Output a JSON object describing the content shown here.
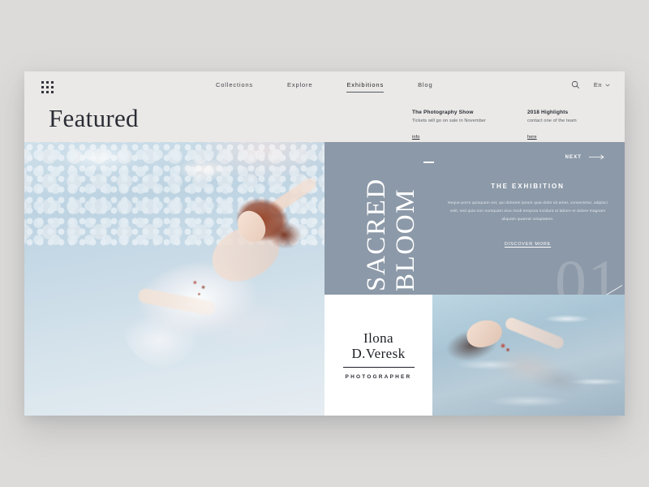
{
  "header": {
    "grid_icon": "grid-menu-icon",
    "nav": [
      {
        "label": "Collections",
        "active": false
      },
      {
        "label": "Explore",
        "active": false
      },
      {
        "label": "Exhibitions",
        "active": true
      },
      {
        "label": "Blog",
        "active": false
      }
    ],
    "search_icon": "search-icon",
    "language": "En",
    "chevron_icon": "chevron-down-icon",
    "page_title": "Featured",
    "promos": [
      {
        "title": "The Photography Show",
        "subtitle": "Tickets will go on sale in November",
        "link": "info"
      },
      {
        "title": "2018 Highlights",
        "subtitle": "contact one of the team",
        "link": "here"
      }
    ]
  },
  "hero": {
    "main_photo_alt": "Woman in flowing white dress floating underwater",
    "sub_photo_alt": "Woman with red flower floating at the water surface"
  },
  "panel": {
    "next_label": "NEXT",
    "arrow_icon": "arrow-right-icon",
    "title_line1": "SACRED",
    "title_line2": "BLOOM",
    "eyebrow": "THE EXHIBITION",
    "body": "Neque porro quisquam est, qui dolorem ipsum quia dolor sit amet, consectetur, adipisci velit, sed quia non numquam eius modi tempora incidunt ut labore et dolore magnam aliquam quaerat voluptatem.",
    "cta": "DISCOVER MORE",
    "slide_number": "01",
    "accent_color": "#8c99a8"
  },
  "photographer_card": {
    "name_line1": "Ilona",
    "name_line2": "D.Veresk",
    "role": "PHOTOGRAPHER"
  },
  "colors": {
    "page_background": "#dcdbd9",
    "card_background": "#eae9e7",
    "panel": "#8c99a8",
    "text_dark": "#2b2d35"
  }
}
